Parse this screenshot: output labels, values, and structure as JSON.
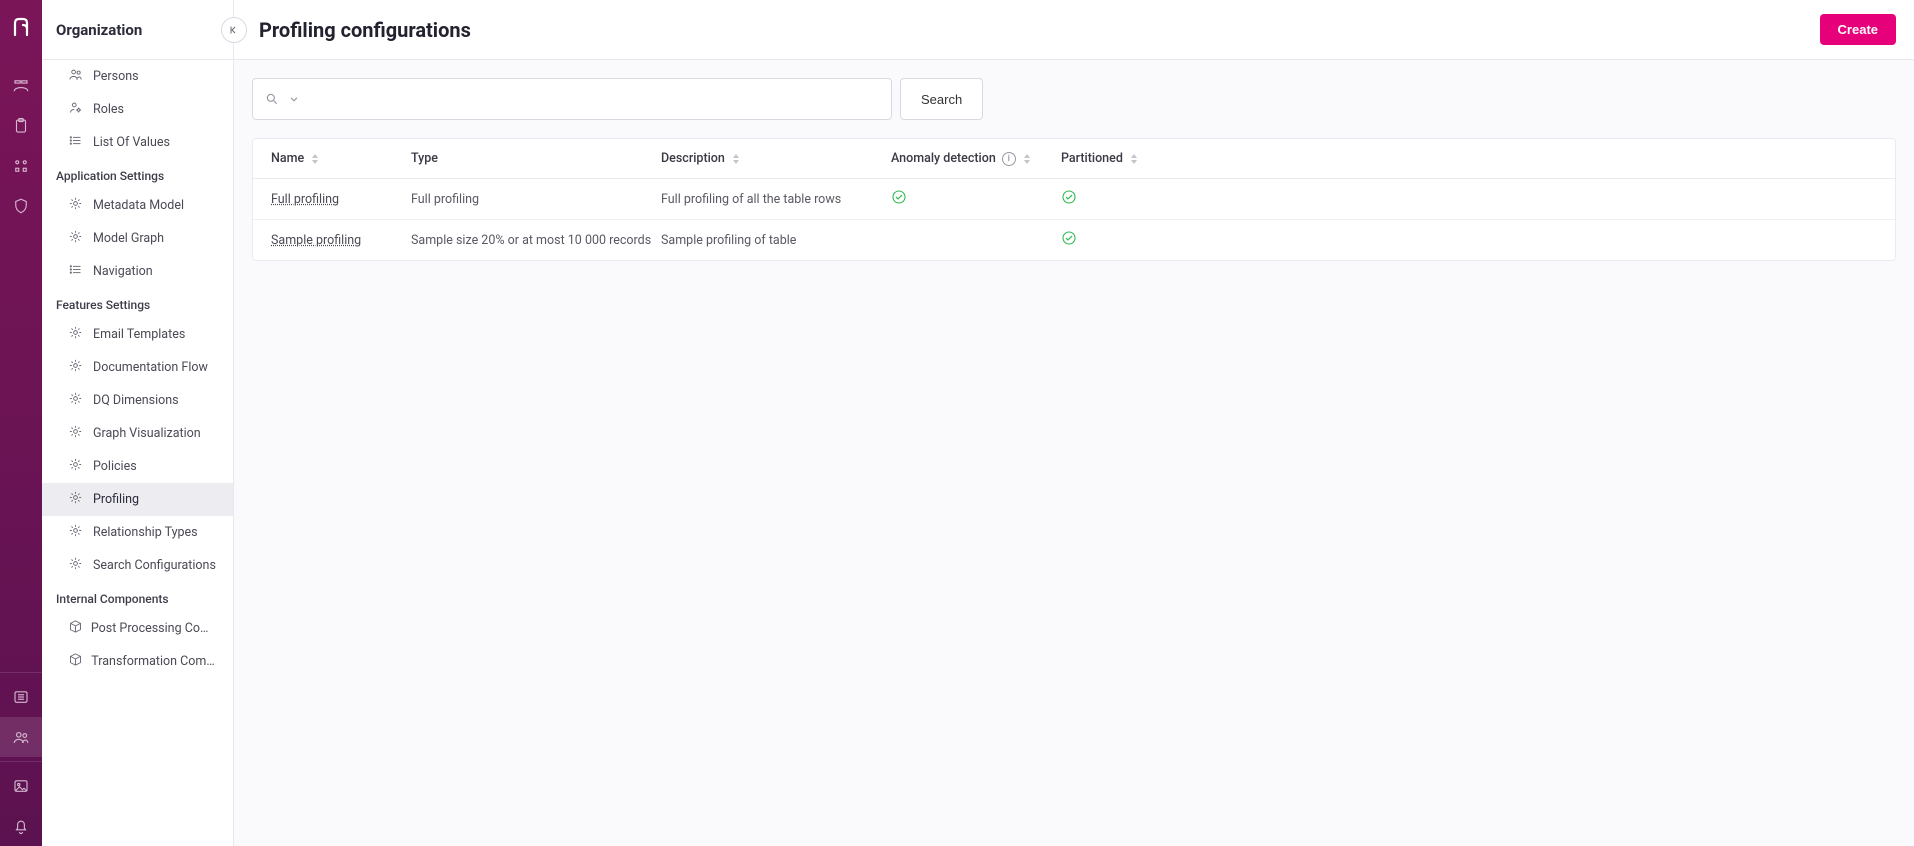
{
  "sidebar": {
    "title": "Organization",
    "top_items": [
      {
        "label": "Persons",
        "icon": "people"
      },
      {
        "label": "Roles",
        "icon": "role"
      },
      {
        "label": "List Of Values",
        "icon": "list"
      }
    ],
    "groups": [
      {
        "title": "Application Settings",
        "items": [
          {
            "label": "Metadata Model",
            "icon": "gear"
          },
          {
            "label": "Model Graph",
            "icon": "gear"
          },
          {
            "label": "Navigation",
            "icon": "list"
          }
        ]
      },
      {
        "title": "Features Settings",
        "items": [
          {
            "label": "Email Templates",
            "icon": "gear"
          },
          {
            "label": "Documentation Flow",
            "icon": "gear"
          },
          {
            "label": "DQ Dimensions",
            "icon": "gear"
          },
          {
            "label": "Graph Visualization",
            "icon": "gear"
          },
          {
            "label": "Policies",
            "icon": "gear"
          },
          {
            "label": "Profiling",
            "icon": "gear",
            "selected": true
          },
          {
            "label": "Relationship Types",
            "icon": "gear"
          },
          {
            "label": "Search Configurations",
            "icon": "gear"
          }
        ]
      },
      {
        "title": "Internal Components",
        "items": [
          {
            "label": "Post Processing Compon…",
            "icon": "package"
          },
          {
            "label": "Transformation Compon…",
            "icon": "package"
          }
        ]
      }
    ]
  },
  "header": {
    "page_title": "Profiling configurations",
    "create_label": "Create"
  },
  "search": {
    "button_label": "Search",
    "placeholder": ""
  },
  "table": {
    "columns": {
      "name": "Name",
      "type": "Type",
      "description": "Description",
      "anomaly": "Anomaly detection",
      "partitioned": "Partitioned"
    },
    "rows": [
      {
        "name": "Full profiling",
        "type": "Full profiling",
        "description": "Full profiling of all the table rows",
        "anomaly": true,
        "partitioned": true
      },
      {
        "name": "Sample profiling",
        "type": "Sample size 20% or at most 10 000 records",
        "description": "Sample profiling of table",
        "anomaly": false,
        "partitioned": true
      }
    ]
  }
}
